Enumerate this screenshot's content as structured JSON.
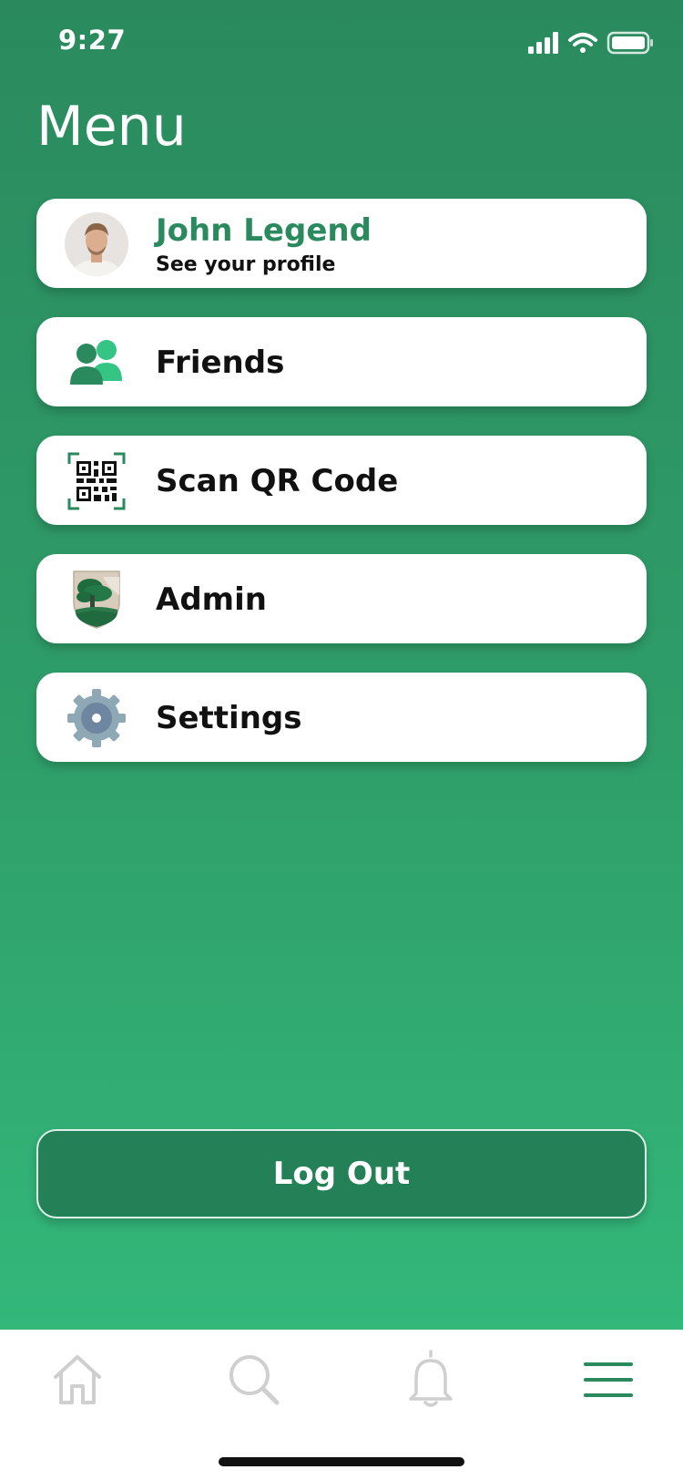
{
  "status": {
    "time": "9:27"
  },
  "header": {
    "title": "Menu"
  },
  "profile": {
    "name": "John Legend",
    "subtitle": "See your profile"
  },
  "menu": {
    "items": [
      {
        "label": "Friends",
        "icon": "friends-icon"
      },
      {
        "label": "Scan QR Code",
        "icon": "qr-code-icon"
      },
      {
        "label": "Admin",
        "icon": "crest-icon"
      },
      {
        "label": "Settings",
        "icon": "gear-icon"
      }
    ]
  },
  "logout": {
    "label": "Log Out"
  },
  "nav": {
    "items": [
      "home-icon",
      "search-icon",
      "bell-icon",
      "hamburger-menu-icon"
    ],
    "active": "hamburger-menu-icon"
  },
  "colors": {
    "brand_green": "#2a8a5e",
    "accent_green": "#34be7e",
    "logout_bg": "#248157",
    "nav_inactive": "#cfcfcf"
  }
}
